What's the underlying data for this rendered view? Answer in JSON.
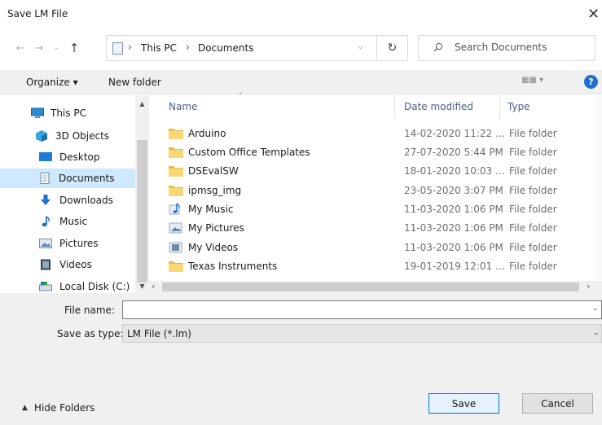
{
  "window": {
    "title": "Save LM File",
    "close_glyph": "✕"
  },
  "address_bar": {
    "path": [
      "This PC",
      "Documents"
    ],
    "separator": "›"
  },
  "search": {
    "placeholder": "Search Documents"
  },
  "toolbar": {
    "organize_label": "Organize ▾",
    "new_folder_label": "New folder",
    "help_glyph": "?"
  },
  "nav_pane": {
    "items": [
      {
        "label": "This PC",
        "icon": "this-pc-icon"
      },
      {
        "label": "3D Objects",
        "icon": "3d-objects-icon"
      },
      {
        "label": "Desktop",
        "icon": "desktop-icon"
      },
      {
        "label": "Documents",
        "icon": "documents-icon",
        "selected": true
      },
      {
        "label": "Downloads",
        "icon": "downloads-icon"
      },
      {
        "label": "Music",
        "icon": "music-icon"
      },
      {
        "label": "Pictures",
        "icon": "pictures-icon"
      },
      {
        "label": "Videos",
        "icon": "videos-icon"
      },
      {
        "label": "Local Disk (C:)",
        "icon": "local-disk-icon"
      }
    ]
  },
  "file_list": {
    "columns": {
      "name": "Name",
      "date": "Date modified",
      "type": "Type"
    },
    "rows": [
      {
        "name": "Arduino",
        "date": "14-02-2020 11:22 ...",
        "type": "File folder",
        "icon": "folder-icon"
      },
      {
        "name": "Custom Office Templates",
        "date": "27-07-2020 5:44 PM",
        "type": "File folder",
        "icon": "folder-icon"
      },
      {
        "name": "DSEvalSW",
        "date": "18-01-2020 10:03 ...",
        "type": "File folder",
        "icon": "folder-icon"
      },
      {
        "name": "ipmsg_img",
        "date": "23-05-2020 3:07 PM",
        "type": "File folder",
        "icon": "folder-icon"
      },
      {
        "name": "My Music",
        "date": "11-03-2020 1:06 PM",
        "type": "File folder",
        "icon": "music-shortcut-icon"
      },
      {
        "name": "My Pictures",
        "date": "11-03-2020 1:06 PM",
        "type": "File folder",
        "icon": "pictures-shortcut-icon"
      },
      {
        "name": "My Videos",
        "date": "11-03-2020 1:06 PM",
        "type": "File folder",
        "icon": "videos-shortcut-icon"
      },
      {
        "name": "Texas Instruments",
        "date": "19-01-2019 12:01 ...",
        "type": "File folder",
        "icon": "folder-icon"
      }
    ]
  },
  "form": {
    "file_name_label": "File name:",
    "file_name_value": "",
    "save_type_label": "Save as type:",
    "save_type_value": "LM File (*.lm)"
  },
  "footer": {
    "hide_folders_label": "Hide Folders",
    "save_label": "Save",
    "cancel_label": "Cancel"
  },
  "colors": {
    "accent": "#0078d7",
    "selection": "#cde8ff",
    "folder": "#f8d775",
    "header_text": "#4a5f82"
  }
}
